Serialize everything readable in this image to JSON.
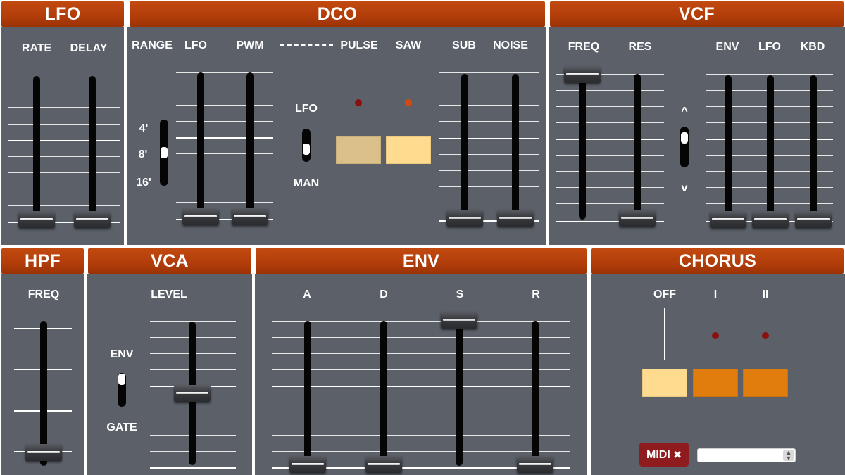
{
  "colors": {
    "panel": "#5b6069",
    "header": "#b33e0a",
    "button_light": "#fedb8e",
    "button_dim": "#dcc089",
    "button_orange": "#e07d0c",
    "led_red": "#8a1010",
    "led_orange": "#d34a12",
    "midi": "#8e1b1e"
  },
  "lfo": {
    "title": "LFO",
    "rate_label": "RATE",
    "delay_label": "DELAY",
    "rate_value": 0.0,
    "delay_value": 0.0
  },
  "dco": {
    "title": "DCO",
    "range_label": "RANGE",
    "lfo_label": "LFO",
    "pwm_label": "PWM",
    "pulse_label": "PULSE",
    "saw_label": "SAW",
    "sub_label": "SUB",
    "noise_label": "NOISE",
    "range_options": [
      "4'",
      "8'",
      "16'"
    ],
    "range_selected": "8'",
    "pwm_mode_top": "LFO",
    "pwm_mode_bottom": "MAN",
    "lfo_value": 0.0,
    "pwm_value": 0.0,
    "sub_value": 0.0,
    "noise_value": 0.0
  },
  "vcf": {
    "title": "VCF",
    "freq_label": "FREQ",
    "res_label": "RES",
    "env_label": "ENV",
    "lfo_label": "LFO",
    "kbd_label": "KBD",
    "polarity_up": "^",
    "polarity_down": "v",
    "freq_value": 1.0,
    "res_value": 0.0,
    "env_value": 0.0,
    "lfo_value": 0.0,
    "kbd_value": 0.0
  },
  "hpf": {
    "title": "HPF",
    "freq_label": "FREQ",
    "freq_value": 0.0
  },
  "vca": {
    "title": "VCA",
    "level_label": "LEVEL",
    "env_label": "ENV",
    "gate_label": "GATE",
    "level_value": 0.5
  },
  "env": {
    "title": "ENV",
    "a_label": "A",
    "d_label": "D",
    "s_label": "S",
    "r_label": "R",
    "a_value": 0.0,
    "d_value": 0.0,
    "s_value": 1.0,
    "r_value": 0.0
  },
  "chorus": {
    "title": "CHORUS",
    "off_label": "OFF",
    "i_label": "I",
    "ii_label": "II",
    "midi_label": "MIDI",
    "midi_close": "✖",
    "midi_select_value": ""
  }
}
